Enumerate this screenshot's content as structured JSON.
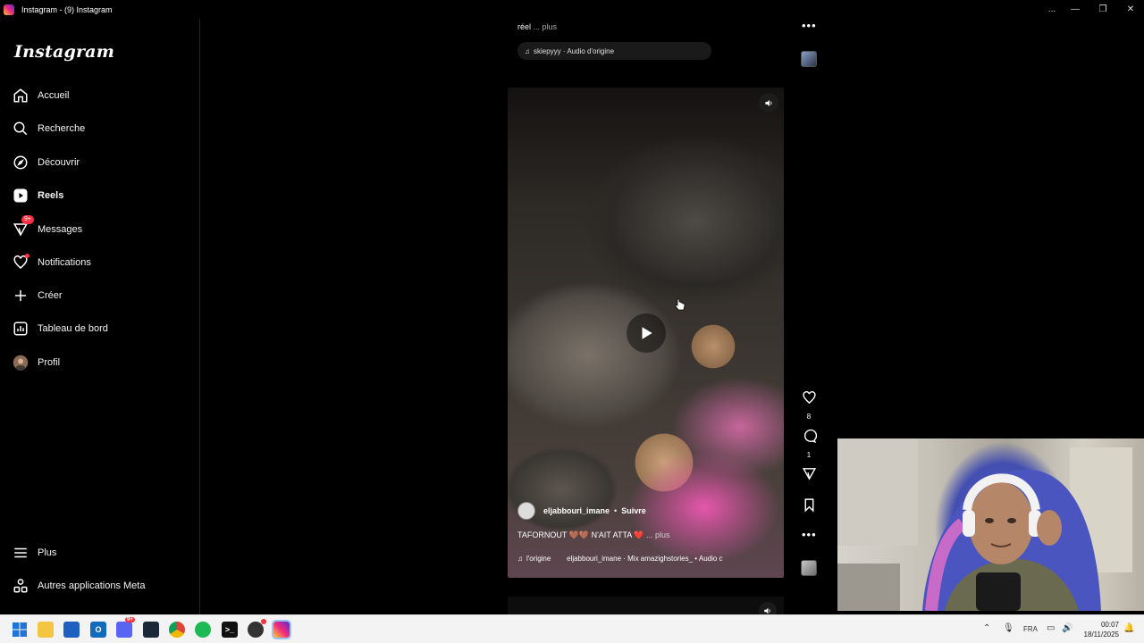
{
  "window": {
    "title": "Instagram - (9) Instagram",
    "controls": [
      "...",
      "—",
      "❐",
      "✕"
    ]
  },
  "sidebar": {
    "logo": "Instagram",
    "items": [
      {
        "label": "Accueil",
        "icon": "home-icon"
      },
      {
        "label": "Recherche",
        "icon": "search-icon"
      },
      {
        "label": "Découvrir",
        "icon": "compass-icon"
      },
      {
        "label": "Reels",
        "icon": "reels-icon",
        "active": true
      },
      {
        "label": "Messages",
        "icon": "messenger-icon",
        "badge": "9+"
      },
      {
        "label": "Notifications",
        "icon": "heart-icon",
        "dot": true
      },
      {
        "label": "Créer",
        "icon": "plus-icon"
      },
      {
        "label": "Tableau de bord",
        "icon": "dashboard-icon"
      },
      {
        "label": "Profil",
        "icon": "avatar-icon"
      }
    ],
    "bottom_items": [
      {
        "label": "Plus",
        "icon": "menu-icon"
      },
      {
        "label": "Autres applications Meta",
        "icon": "meta-apps-icon"
      }
    ]
  },
  "prev_post": {
    "caption": "réel",
    "more": "... plus",
    "audio": "skiepyyy · Audio d'origine"
  },
  "reel": {
    "username": "eljabbouri_imane",
    "separator": "•",
    "follow": "Suivre",
    "caption": "TAFORNOUT 🤎🤎 N'AIT ATTA ❤️",
    "caption_more": "... plus",
    "audio": "l'origine        eljabbouri_imane · Mix amazighstories_ • Audio c",
    "likes": "8",
    "comments": "1"
  },
  "colors": {
    "background": "#000000",
    "accent_red": "#ff3040",
    "taskbar": "#f3f3f3"
  },
  "taskbar": {
    "language": "FRA",
    "time": "00:07",
    "date": "18/11/2025",
    "steam_badge": "9+"
  }
}
